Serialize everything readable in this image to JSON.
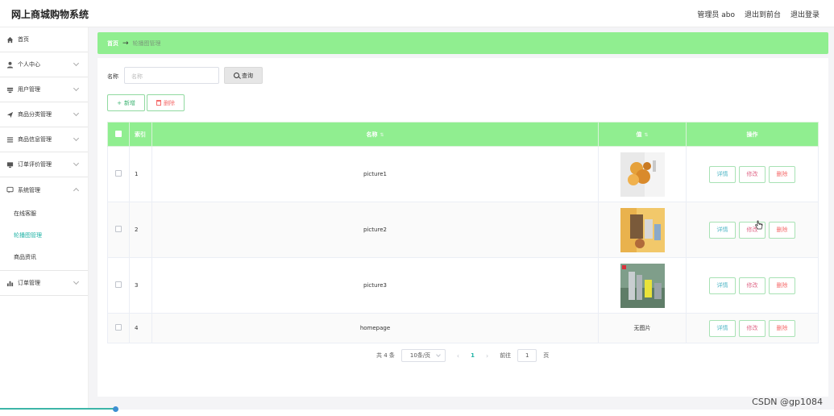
{
  "app": {
    "title": "网上商城购物系统"
  },
  "topbar": {
    "admin_label": "管理员 abo",
    "front_label": "退出到前台",
    "logout_label": "退出登录"
  },
  "sidebar": {
    "items": [
      {
        "label": "首页",
        "icon": "home-icon",
        "has_chevron": false
      },
      {
        "label": "个人中心",
        "icon": "user-icon",
        "has_chevron": true
      },
      {
        "label": "用户管理",
        "icon": "users-icon",
        "has_chevron": true
      },
      {
        "label": "商品分类管理",
        "icon": "send-icon",
        "has_chevron": true
      },
      {
        "label": "商品信息管理",
        "icon": "list-icon",
        "has_chevron": true
      },
      {
        "label": "订单评价管理",
        "icon": "monitor-icon",
        "has_chevron": true
      },
      {
        "label": "系统管理",
        "icon": "chat-icon",
        "has_chevron": true,
        "expanded": true
      },
      {
        "label": "订单管理",
        "icon": "chart-icon",
        "has_chevron": true
      }
    ],
    "sub_items": [
      {
        "label": "在线客服",
        "active": false
      },
      {
        "label": "轮播图管理",
        "active": true
      },
      {
        "label": "商品资讯",
        "active": false
      }
    ]
  },
  "breadcrumb": {
    "home": "首页",
    "arrow": "→",
    "current": "轮播图管理"
  },
  "search": {
    "label": "名称",
    "placeholder": "名称",
    "button": "查询"
  },
  "actions": {
    "add": "新增",
    "delete": "删除"
  },
  "table": {
    "headers": {
      "index": "索引",
      "name": "名称",
      "value": "值",
      "ops": "操作"
    },
    "rows": [
      {
        "index": "1",
        "name": "picture1",
        "image": "thumb-1",
        "value_text": ""
      },
      {
        "index": "2",
        "name": "picture2",
        "image": "thumb-2",
        "value_text": ""
      },
      {
        "index": "3",
        "name": "picture3",
        "image": "thumb-3",
        "value_text": ""
      },
      {
        "index": "4",
        "name": "homepage",
        "image": "",
        "value_text": "无图片"
      }
    ],
    "op_labels": {
      "detail": "详情",
      "edit": "修改",
      "delete": "删除"
    }
  },
  "pagination": {
    "total": "共 4 条",
    "page_size": "10条/页",
    "prev": "‹",
    "current": "1",
    "next": "›",
    "goto_label": "前往",
    "goto_value": "1",
    "page_suffix": "页"
  },
  "watermark": "CSDN @gp1084",
  "colors": {
    "accent_green": "#90ee90",
    "teal": "#21b3a6",
    "danger": "#f56c6c"
  }
}
